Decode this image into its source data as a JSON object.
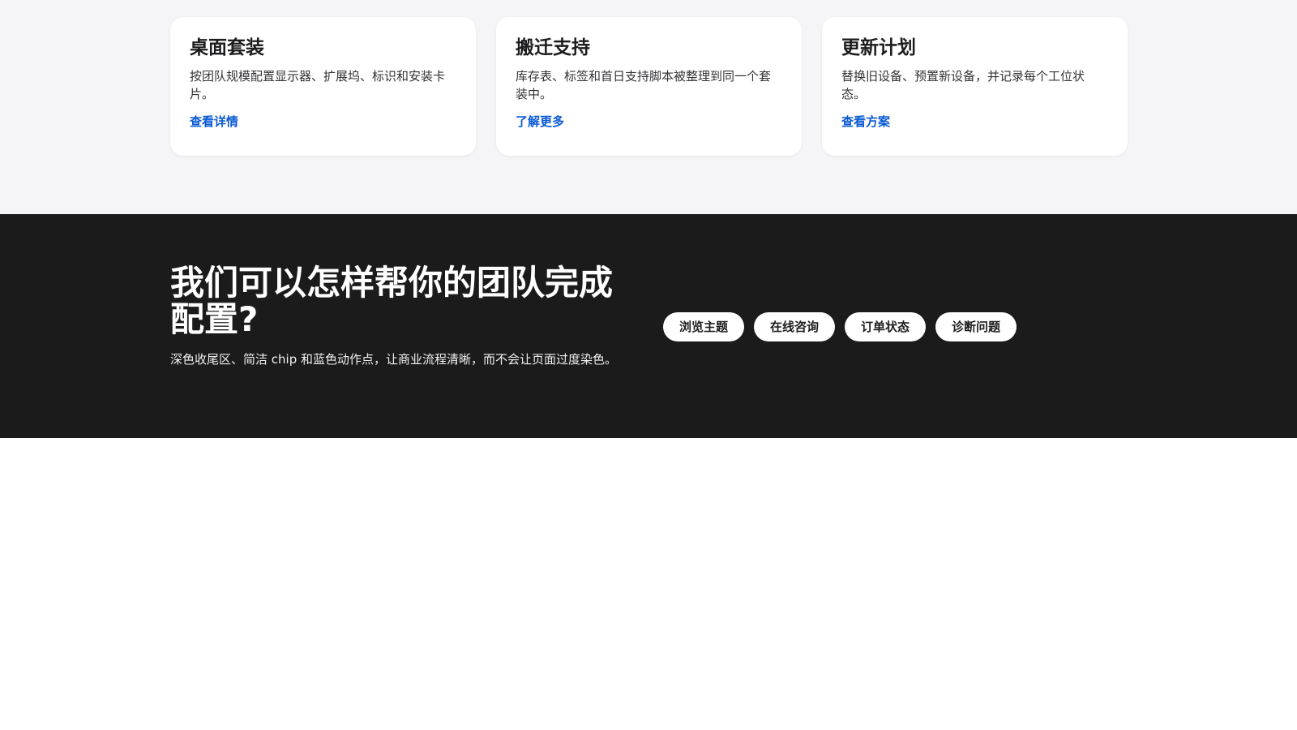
{
  "cards": [
    {
      "title": "桌面套装",
      "description": "按团队规模配置显示器、扩展坞、标识和安装卡片。",
      "link_label": "查看详情"
    },
    {
      "title": "搬迁支持",
      "description": "库存表、标签和首日支持脚本被整理到同一个套装中。",
      "link_label": "了解更多"
    },
    {
      "title": "更新计划",
      "description": "替换旧设备、预置新设备，并记录每个工位状态。",
      "link_label": "查看方案"
    }
  ],
  "help": {
    "title": "我们可以怎样帮你的团队完成配置?",
    "description": "深色收尾区、简洁 chip 和蓝色动作点，让商业流程清晰，而不会让页面过度染色。",
    "chips": [
      "浏览主题",
      "在线咨询",
      "订单状态",
      "诊断问题"
    ]
  },
  "colors": {
    "section_background": "#f5f5f7",
    "dark_background": "#1b1b1b",
    "link_blue": "#0a5ad4",
    "card_background": "#ffffff"
  }
}
